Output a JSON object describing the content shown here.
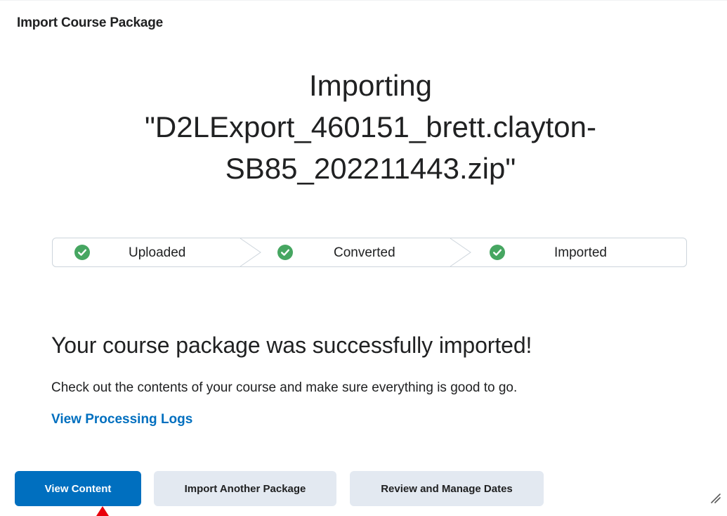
{
  "page": {
    "title": "Import Course Package"
  },
  "import": {
    "heading_line1": "Importing",
    "heading_line2": "\"D2LExport_460151_brett.clayton-",
    "heading_line3": "SB85_202211443.zip\""
  },
  "stepper": {
    "steps": [
      {
        "label": "Uploaded",
        "status": "complete",
        "icon": "check-circle-icon"
      },
      {
        "label": "Converted",
        "status": "complete",
        "icon": "check-circle-icon"
      },
      {
        "label": "Imported",
        "status": "complete",
        "icon": "check-circle-icon"
      }
    ]
  },
  "result": {
    "heading": "Your course package was successfully imported!",
    "description": "Check out the contents of your course and make sure everything is good to go.",
    "logs_link": "View Processing Logs"
  },
  "actions": {
    "view_content": "View Content",
    "import_another": "Import Another Package",
    "review_dates": "Review and Manage Dates"
  },
  "colors": {
    "primary": "#006fbf",
    "success": "#46a661",
    "secondary_button": "#e3e9f1",
    "pointer": "#e8000b"
  }
}
